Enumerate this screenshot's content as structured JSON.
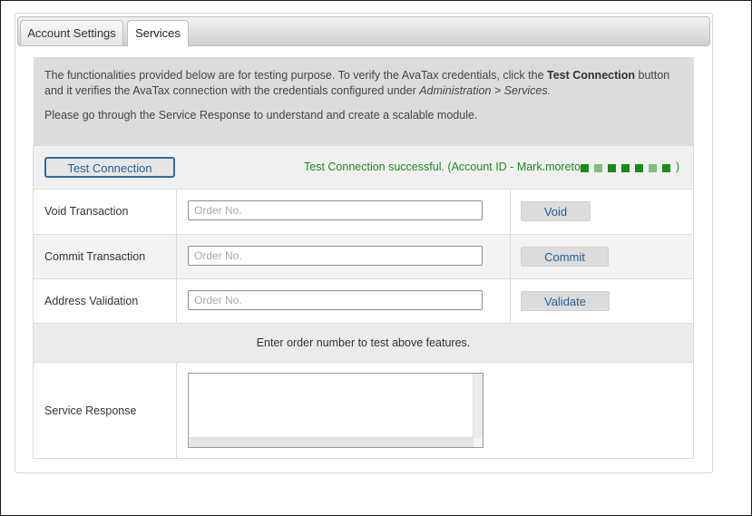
{
  "tabs": [
    {
      "label": "Account Settings",
      "active": false
    },
    {
      "label": "Services",
      "active": true
    }
  ],
  "info": {
    "line1_before": "The functionalities provided below are for testing purpose. To verify the AvaTax credentials, click the ",
    "line1_bold": "Test Connection",
    "line1_after": " button and it verifies the AvaTax connection with the credentials configured under ",
    "line1_italic": "Administration > Services.",
    "line2": "Please go through the Service Response to understand and create a scalable module."
  },
  "test_connection": {
    "button_label": "Test Connection",
    "status_text": "Test Connection successful. (Account ID - Mark.moreto",
    "status_close": ")",
    "status_color": "#1e8a1e"
  },
  "rows": [
    {
      "label": "Void Transaction",
      "placeholder": "Order No.",
      "button": "Void"
    },
    {
      "label": "Commit Transaction",
      "placeholder": "Order No.",
      "button": "Commit"
    },
    {
      "label": "Address Validation",
      "placeholder": "Order No.",
      "button": "Validate"
    }
  ],
  "hint": "Enter order number to test above features.",
  "service_response": {
    "label": "Service Response"
  },
  "colors": {
    "link_blue": "#1f5f99",
    "info_bg": "#dcdcdc",
    "success_green": "#1e8a1e"
  }
}
